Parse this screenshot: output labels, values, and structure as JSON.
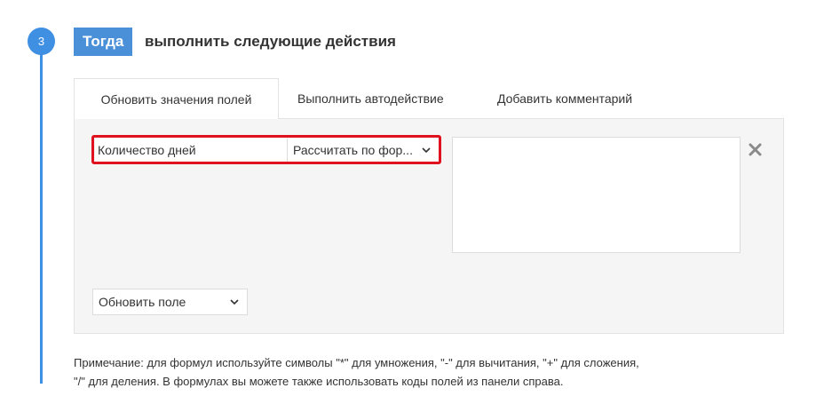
{
  "step": {
    "number": "3",
    "badge": "Тогда",
    "title": "выполнить следующие действия"
  },
  "tabs": [
    {
      "label": "Обновить значения полей",
      "active": true
    },
    {
      "label": "Выполнить автодействие",
      "active": false
    },
    {
      "label": "Добавить комментарий",
      "active": false
    }
  ],
  "action_row": {
    "field_name": "Количество дней",
    "formula_mode": "Рассчитать по фор...",
    "formula_value": ""
  },
  "add_field": {
    "label": "Обновить поле"
  },
  "note": {
    "line1": "Примечание: для формул используйте символы \"*\" для умножения, \"-\" для вычитания, \"+\" для сложения,",
    "line2": "\"/\" для деления. В формулах вы можете также использовать коды полей из панели справа."
  },
  "colors": {
    "accent": "#4a90d9",
    "highlight": "#e0121f"
  },
  "icons": {
    "remove": "close-x-icon",
    "dropdown": "chevron-down-icon"
  }
}
